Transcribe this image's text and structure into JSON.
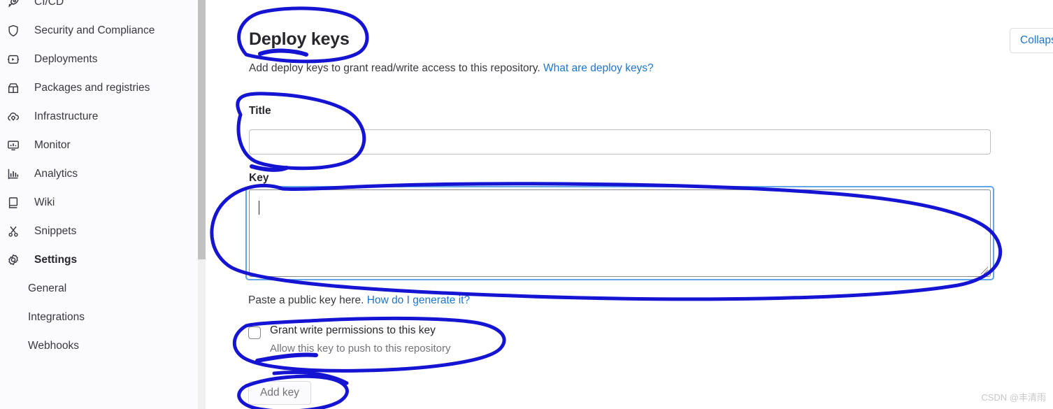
{
  "sidebar": {
    "clipped_top_item": {
      "label": "",
      "icon": "merge-requests-icon",
      "badge": ""
    },
    "items": [
      {
        "label": "CI/CD",
        "icon": "rocket-icon",
        "active": false,
        "sub": false
      },
      {
        "label": "Security and Compliance",
        "icon": "shield-icon",
        "active": false,
        "sub": false
      },
      {
        "label": "Deployments",
        "icon": "deployments-icon",
        "active": false,
        "sub": false
      },
      {
        "label": "Packages and registries",
        "icon": "package-icon",
        "active": false,
        "sub": false
      },
      {
        "label": "Infrastructure",
        "icon": "cloud-gear-icon",
        "active": false,
        "sub": false
      },
      {
        "label": "Monitor",
        "icon": "monitor-icon",
        "active": false,
        "sub": false
      },
      {
        "label": "Analytics",
        "icon": "chart-icon",
        "active": false,
        "sub": false
      },
      {
        "label": "Wiki",
        "icon": "book-icon",
        "active": false,
        "sub": false
      },
      {
        "label": "Snippets",
        "icon": "scissors-icon",
        "active": false,
        "sub": false
      },
      {
        "label": "Settings",
        "icon": "gear-icon",
        "active": true,
        "sub": false
      },
      {
        "label": "General",
        "icon": "",
        "active": false,
        "sub": true
      },
      {
        "label": "Integrations",
        "icon": "",
        "active": false,
        "sub": true
      },
      {
        "label": "Webhooks",
        "icon": "",
        "active": false,
        "sub": true
      }
    ]
  },
  "main": {
    "title": "Deploy keys",
    "description_text": "Add deploy keys to grant read/write access to this repository.",
    "description_link": "What are deploy keys?",
    "collapse_button_label": "Collapse",
    "form": {
      "title_label": "Title",
      "title_value": "",
      "title_placeholder": "",
      "key_label": "Key",
      "key_value": "",
      "key_placeholder": "",
      "key_help_text": "Paste a public key here.",
      "key_help_link": "How do I generate it?",
      "permission_label": "Grant write permissions to this key",
      "permission_help": "Allow this key to push to this repository",
      "permission_checked": false,
      "submit_label": "Add key",
      "submit_disabled": true
    }
  },
  "watermark": "CSDN @丰清雨",
  "colors": {
    "link": "#1f75cb",
    "text": "#3a383f",
    "heading": "#28272d",
    "muted": "#737278",
    "sidebar_bg": "#fbfafd",
    "focus_ring": "#63a6e9",
    "annotation": "#1414d2",
    "scrollbar_thumb": "#c1c1c1"
  }
}
